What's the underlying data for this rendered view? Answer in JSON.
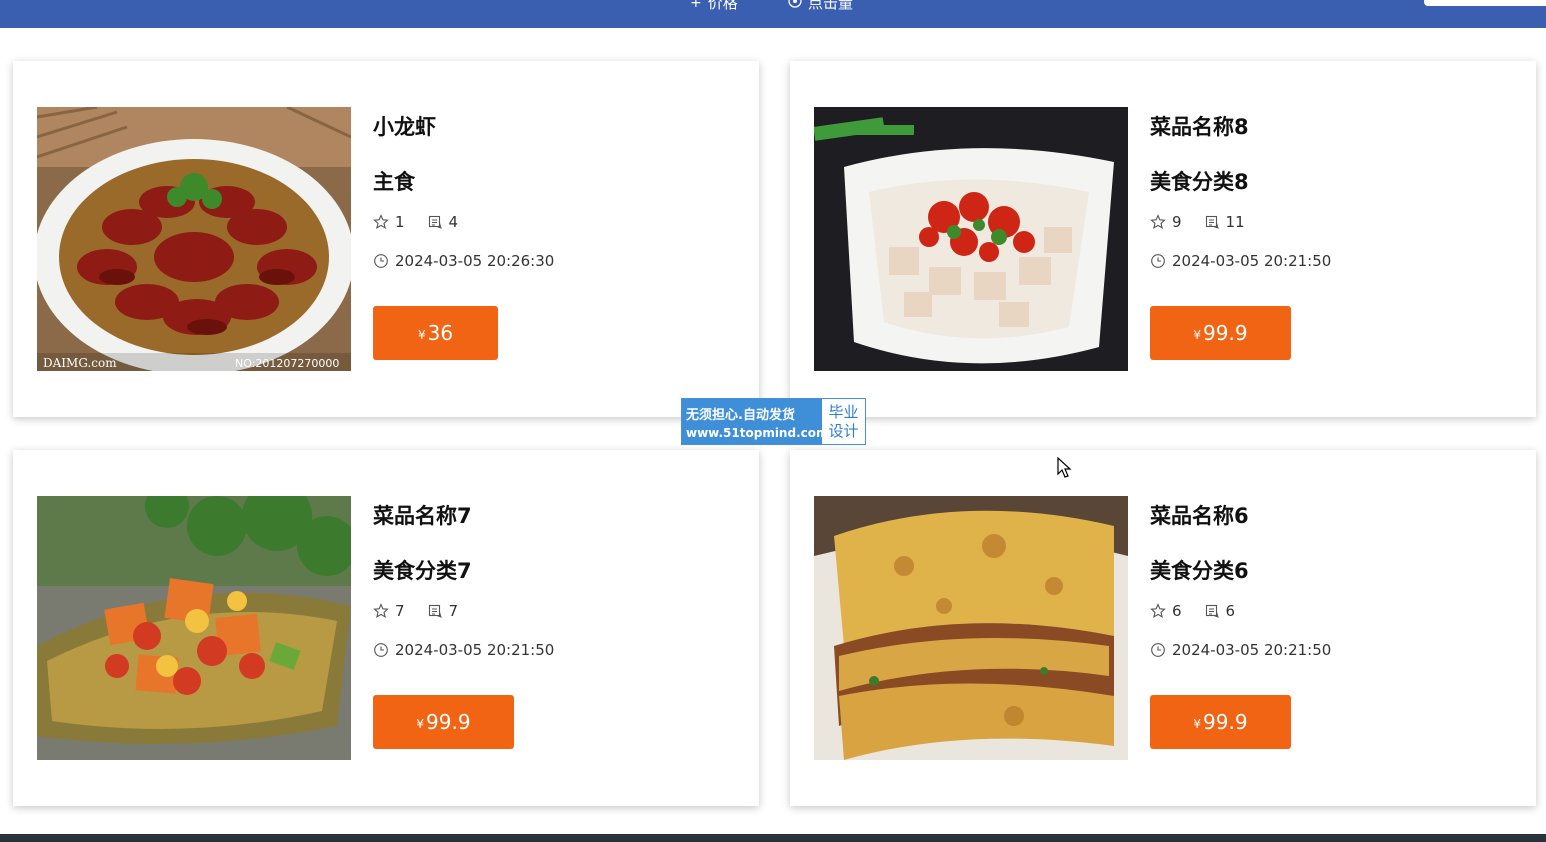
{
  "header": {
    "sort_price_label": "价格",
    "sort_views_label": "点击量",
    "sort_price_icon": "plus-icon",
    "sort_views_icon": "eye-icon"
  },
  "items": [
    {
      "name": "小龙虾",
      "category": "主食",
      "likes": "1",
      "comments": "4",
      "time": "2024-03-05 20:26:30",
      "currency": "¥",
      "price": "36",
      "image": "crayfish-dish-image",
      "image_watermark_left": "DAIMG.com",
      "image_watermark_right": "NO:201207270000"
    },
    {
      "name": "菜品名称8",
      "category": "美食分类8",
      "likes": "9",
      "comments": "11",
      "time": "2024-03-05 20:21:50",
      "currency": "¥",
      "price": "99.9",
      "image": "lotus-root-pepper-dish-image"
    },
    {
      "name": "菜品名称7",
      "category": "美食分类7",
      "likes": "7",
      "comments": "7",
      "time": "2024-03-05 20:21:50",
      "currency": "¥",
      "price": "99.9",
      "image": "pineapple-sweet-sour-dish-image"
    },
    {
      "name": "菜品名称6",
      "category": "美食分类6",
      "likes": "6",
      "comments": "6",
      "time": "2024-03-05 20:21:50",
      "currency": "¥",
      "price": "99.9",
      "image": "egg-pancake-roll-image"
    }
  ],
  "watermark": {
    "line1": "无须担心.自动发货",
    "line2": "www.51topmind.com",
    "tag_line1": "毕业",
    "tag_line2": "设计"
  },
  "colors": {
    "header_bg": "#3b5fb0",
    "price_button": "#f06414",
    "watermark_blue": "#3f8fd8"
  }
}
